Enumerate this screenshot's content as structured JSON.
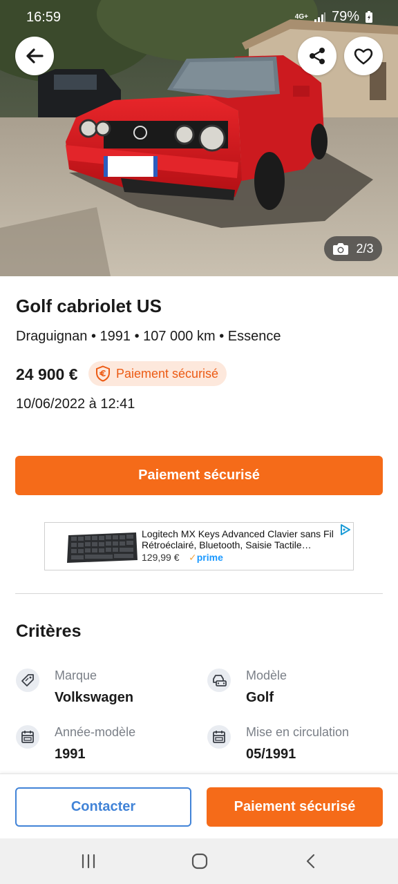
{
  "status_bar": {
    "time": "16:59",
    "network": "4G+",
    "battery": "79%"
  },
  "photo": {
    "counter": "2/3",
    "plate_color": "#ffffff"
  },
  "listing": {
    "title": "Golf cabriolet US",
    "meta": "Draguignan • 1991 • 107 000 km • Essence",
    "price": "24 900 €",
    "secure_badge": "Paiement sécurisé",
    "date": "10/06/2022 à 12:41",
    "pay_button": "Paiement sécurisé"
  },
  "ad": {
    "title": "Logitech MX Keys Advanced Clavier sans Fil Rétroéclairé, Bluetooth, Saisie Tactile…",
    "price": "129,99 €",
    "prime": "prime"
  },
  "criteria": {
    "title": "Critères",
    "items": [
      {
        "label": "Marque",
        "value": "Volkswagen",
        "icon": "tag-icon"
      },
      {
        "label": "Modèle",
        "value": "Golf",
        "icon": "car-icon"
      },
      {
        "label": "Année-modèle",
        "value": "1991",
        "icon": "calendar-icon"
      },
      {
        "label": "Mise en circulation",
        "value": "05/1991",
        "icon": "calendar-icon"
      }
    ]
  },
  "bottom": {
    "contact": "Contacter",
    "pay": "Paiement sécurisé"
  },
  "colors": {
    "accent_orange": "#f56b19",
    "badge_bg": "#fde8dc",
    "contact_blue": "#4183d7",
    "car_red": "#d8141a"
  }
}
